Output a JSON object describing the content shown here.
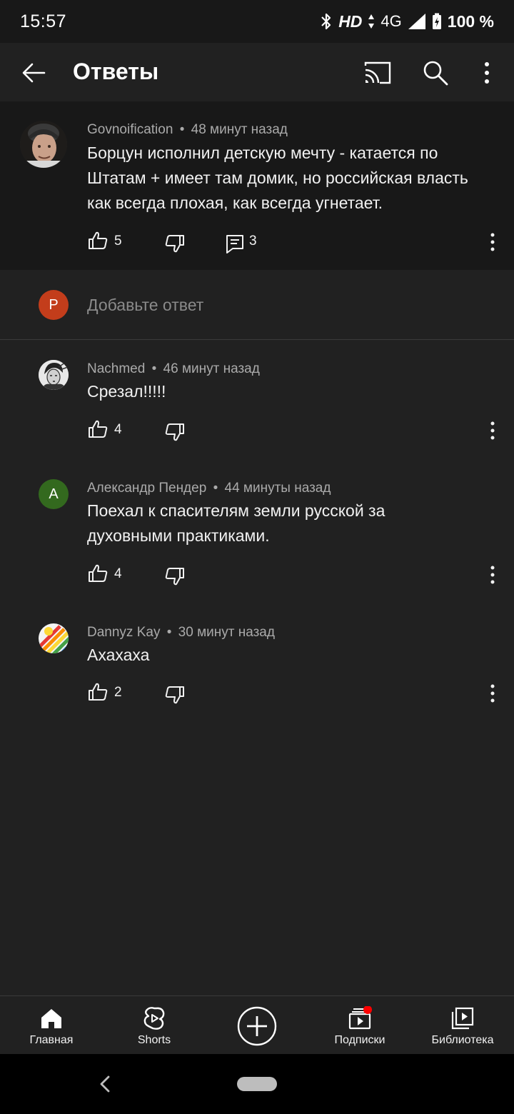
{
  "status_bar": {
    "time": "15:57",
    "hd": "HD",
    "network": "4G",
    "battery": "100 %",
    "icons": [
      "bluetooth-icon",
      "data-arrows-icon",
      "signal-icon",
      "battery-charging-icon"
    ]
  },
  "app_bar": {
    "title": "Ответы",
    "icons": [
      "back-arrow-icon",
      "cast-icon",
      "search-icon",
      "more-vert-icon"
    ]
  },
  "parent_comment": {
    "author": "Govnoification",
    "time": "48 минут назад",
    "separator": "•",
    "text": "Борцун исполнил детскую мечту - катается по Штатам + имеет там домик, но российская власть как всегда плохая, как всегда угнетает.",
    "likes": "5",
    "replies": "3"
  },
  "add_reply": {
    "avatar_letter": "P",
    "placeholder": "Добавьте ответ"
  },
  "replies": [
    {
      "author": "Nachmed",
      "time": "46 минут назад",
      "text": "Срезал!!!!!",
      "likes": "4",
      "avatar": "photo"
    },
    {
      "author": "Александр Пендер",
      "time": "44 минуты назад",
      "text": "Поехал к спасителям земли русской за духовными практиками.",
      "likes": "4",
      "avatar_letter": "А"
    },
    {
      "author": "Dannyz Kay",
      "time": "30 минут назад",
      "text": "Ахахаха",
      "likes": "2",
      "avatar": "rainbow"
    }
  ],
  "bottom_nav": {
    "items": [
      {
        "label": "Главная",
        "icon": "home-icon"
      },
      {
        "label": "Shorts",
        "icon": "shorts-icon"
      },
      {
        "label": "",
        "icon": "create-plus-icon"
      },
      {
        "label": "Подписки",
        "icon": "subscriptions-icon"
      },
      {
        "label": "Библиотека",
        "icon": "library-icon"
      }
    ]
  },
  "colors": {
    "background": "#212121",
    "parent_background": "#181818",
    "meta_text": "#aaaaaa",
    "reply_avatar_p": "#c33d1b",
    "reply_avatar_a": "#33691e",
    "notification_dot": "#ff0000"
  }
}
